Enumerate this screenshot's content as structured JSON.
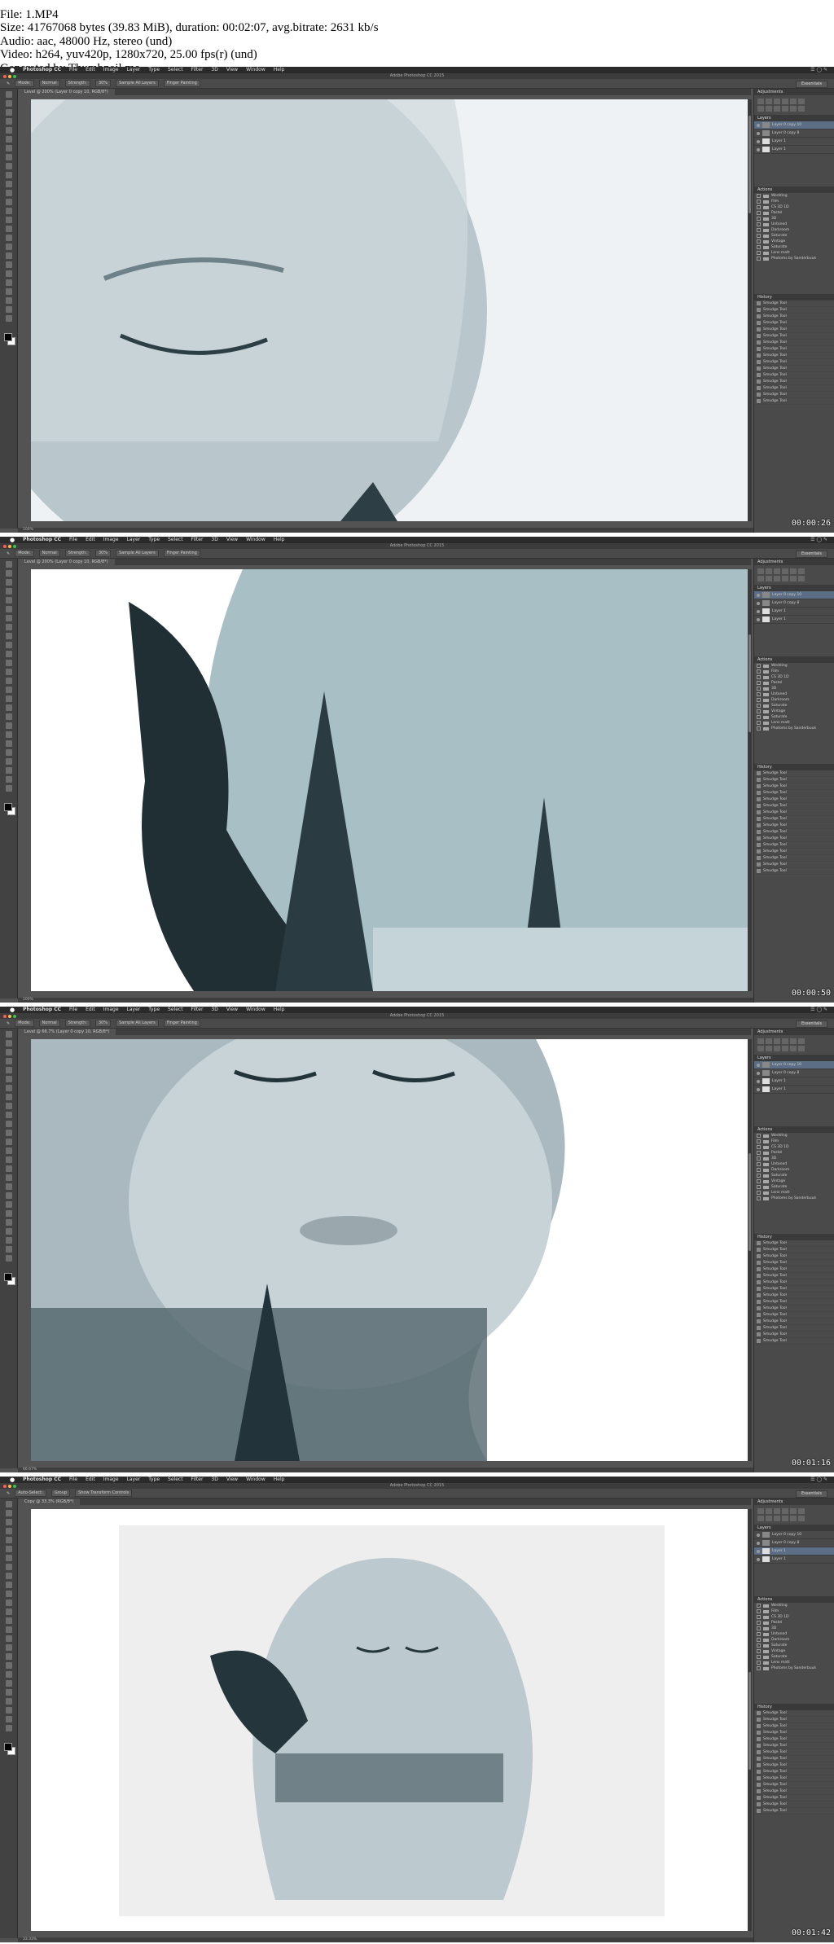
{
  "file_info": [
    "File: 1.MP4",
    "Size: 41767068 bytes (39.83 MiB), duration: 00:02:07, avg.bitrate: 2631 kb/s",
    "Audio: aac, 48000 Hz, stereo (und)",
    "Video: h264, yuv420p, 1280x720, 25.00 fps(r) (und)",
    "Generated by Thumbnail me"
  ],
  "app": {
    "apple": "",
    "menus": [
      "Photoshop CC",
      "File",
      "Edit",
      "Image",
      "Layer",
      "Type",
      "Select",
      "Filter",
      "3D",
      "View",
      "Window",
      "Help"
    ],
    "window_title": "Adobe Photoshop CC 2015",
    "workspace": "Essentials"
  },
  "panels": {
    "adjustments": "Adjustments",
    "layers": "Layers",
    "actions": "Actions",
    "history": "History",
    "layer_names": [
      "Layer 0 copy 10",
      "Layer 0 copy 8",
      "Layer 1",
      "Layer 1"
    ],
    "action_names": [
      "Wedding",
      "Film",
      "CS 3D 1D",
      "Pastel",
      "3D",
      "Untoned",
      "Darkroom",
      "Saturate",
      "Vintage",
      "Saturate",
      "Lens matt",
      "Photoms by Sanderbuuk"
    ],
    "history_item": "Smudge Tool"
  },
  "frames": [
    {
      "timestamp": "00:00:26",
      "tab": "Level @ 200% (Layer 0 copy 10, RGB/8*)",
      "status": "100%",
      "options": [
        "Mode:",
        "Normal",
        "Strength:",
        "30%",
        "Sample All Layers",
        "Finger Painting"
      ],
      "layer_sel": 0,
      "palette": {
        "sky": "#eef2f4",
        "face": "#b9c7cd",
        "dark": "#2d3f45"
      }
    },
    {
      "timestamp": "00:00:50",
      "tab": "Level @ 200% (Layer 0 copy 10, RGB/8*)",
      "status": "100%",
      "options": [
        "Mode:",
        "Normal",
        "Strength:",
        "30%",
        "Sample All Layers",
        "Finger Painting"
      ],
      "layer_sel": 0,
      "palette": {
        "sky": "#a9bfc6",
        "face": "#d9e3e6",
        "dark": "#1f2f34"
      }
    },
    {
      "timestamp": "00:01:16",
      "tab": "Level @ 66.7% (Layer 0 copy 10, RGB/8*)",
      "status": "66.67%",
      "options": [
        "Mode:",
        "Normal",
        "Strength:",
        "30%",
        "Sample All Layers",
        "Finger Painting"
      ],
      "layer_sel": 0,
      "palette": {
        "sky": "#aab9bf",
        "face": "#c8d3d7",
        "dark": "#22333a"
      }
    },
    {
      "timestamp": "00:01:42",
      "tab": "Copy @ 33.3% (RGB/8*)",
      "status": "33.33%",
      "options": [
        "Auto-Select:",
        "Group",
        "Show Transform Controls"
      ],
      "layer_sel": 2,
      "palette": {
        "sky": "#eeeeee",
        "face": "#bcc9ce",
        "dark": "#24363c"
      }
    }
  ],
  "colors": {
    "traffic_red": "#fc605b",
    "traffic_yellow": "#fdbc40",
    "traffic_green": "#34c84a",
    "layer_selected": "#5b6e85"
  }
}
